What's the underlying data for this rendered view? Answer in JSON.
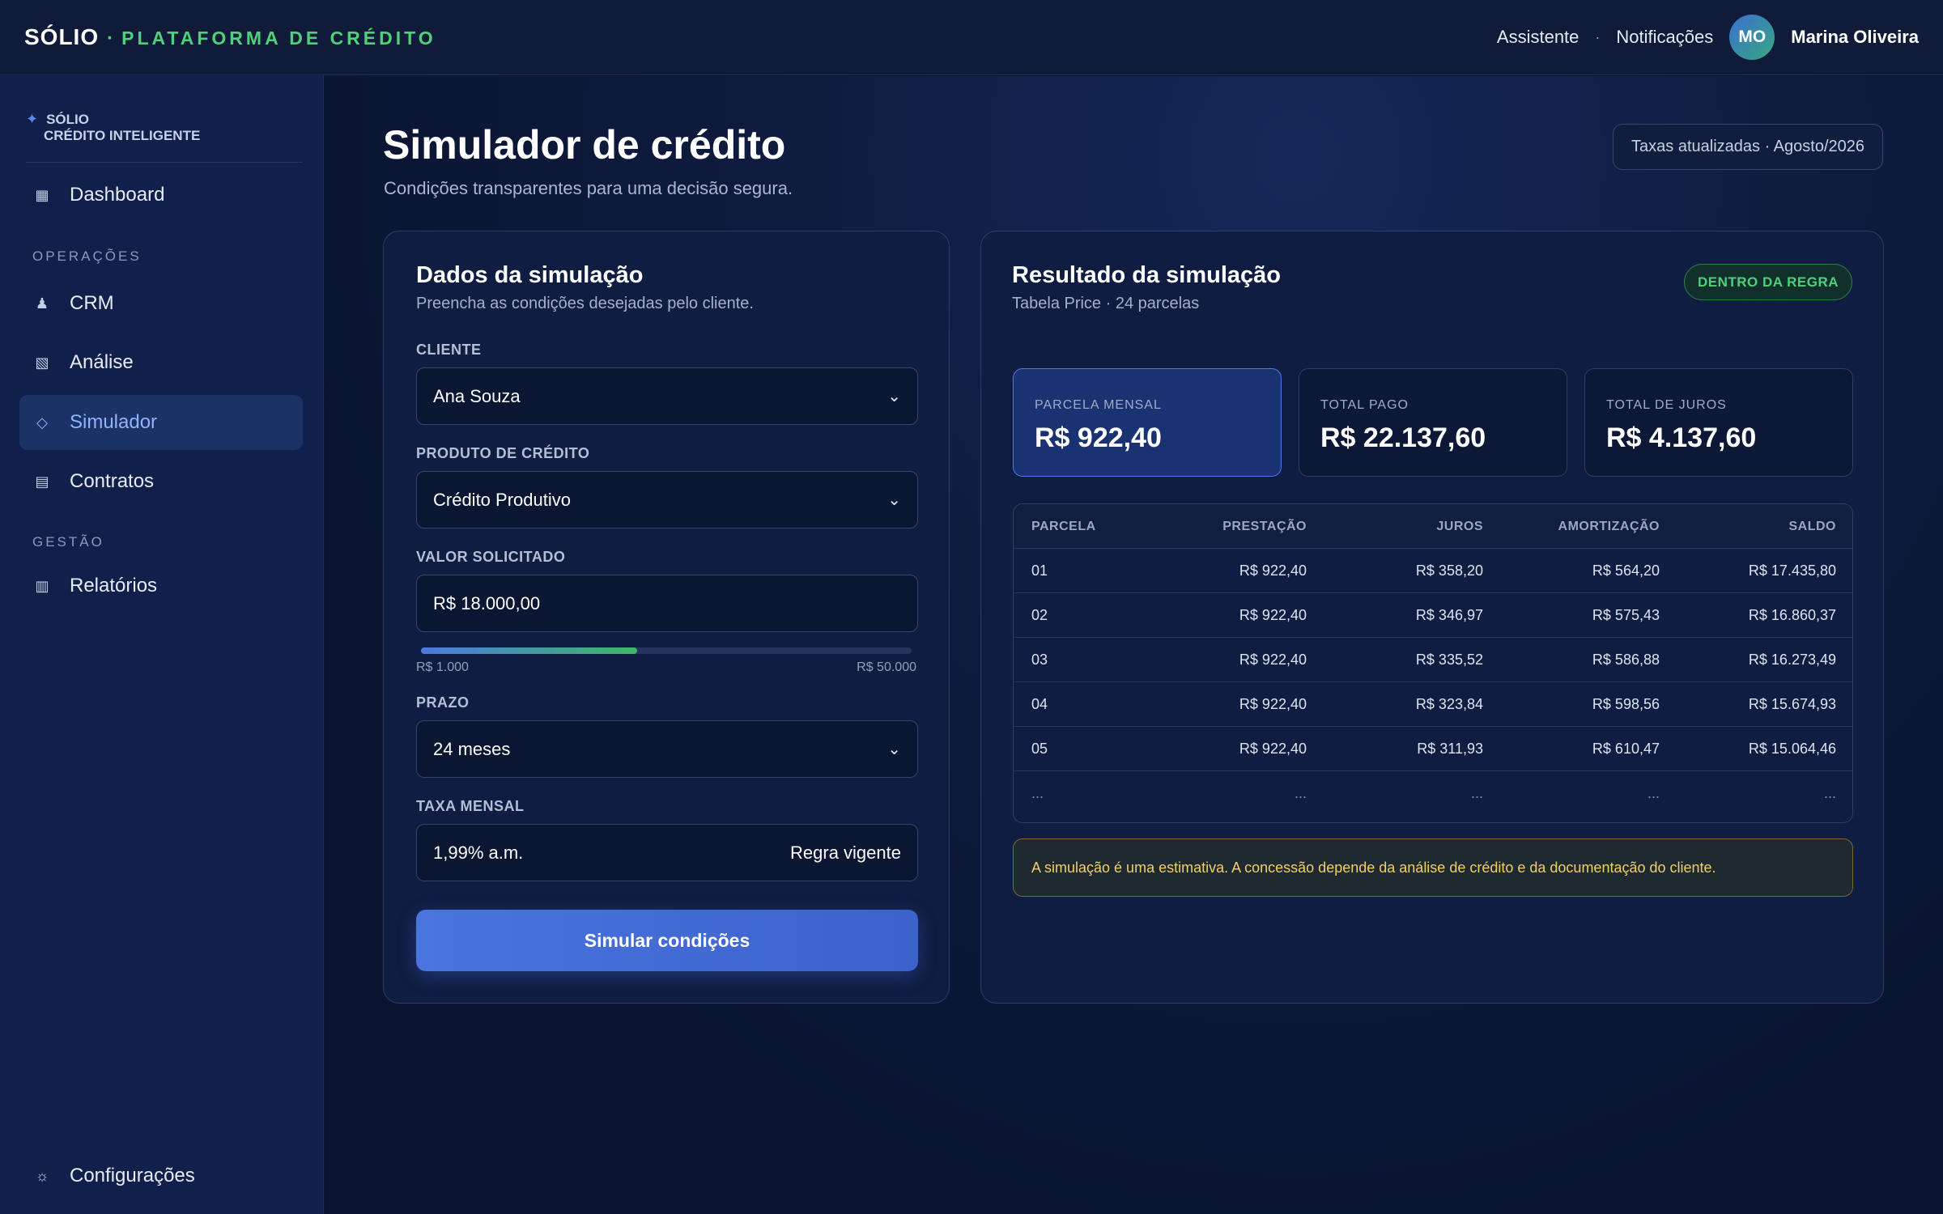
{
  "topbar": {
    "brand": "SÓLIO",
    "brand_dot": "·",
    "brand_sub": "PLATAFORMA DE CRÉDITO",
    "assistant": "Assistente",
    "separator": "·",
    "notifications": "Notificações",
    "avatar_initials": "MO",
    "user_name": "Marina Oliveira"
  },
  "sidebar": {
    "brand_line1": "SÓLIO",
    "brand_line2": "CRÉDITO INTELIGENTE",
    "items": [
      {
        "label": "Dashboard",
        "icon": "dashboard-grid-icon"
      },
      {
        "label": "CRM",
        "icon": "person-icon"
      },
      {
        "label": "Análise",
        "icon": "analysis-icon"
      },
      {
        "label": "Simulador",
        "icon": "diamond-icon",
        "active": true
      },
      {
        "label": "Contratos",
        "icon": "document-icon"
      },
      {
        "label": "Relatórios",
        "icon": "report-icon"
      },
      {
        "label": "Configurações",
        "icon": "gear-icon"
      }
    ],
    "section_operations": "OPERAÇÕES",
    "section_management": "GESTÃO"
  },
  "page": {
    "title": "Simulador de crédito",
    "subtitle": "Condições transparentes para uma decisão segura.",
    "rate_badge": "Taxas atualizadas · Agosto/2026"
  },
  "form": {
    "title": "Dados da simulação",
    "subtitle": "Preencha as condições desejadas pelo cliente.",
    "client_label": "CLIENTE",
    "client_value": "Ana Souza",
    "product_label": "PRODUTO DE CRÉDITO",
    "product_value": "Crédito Produtivo",
    "amount_label": "VALOR SOLICITADO",
    "amount_value": "R$ 18.000,00",
    "amount_slider_fraction": 0.44,
    "range_min": "R$ 1.000",
    "range_max": "R$ 50.000",
    "term_label": "PRAZO",
    "term_value": "24 meses",
    "rate_label": "TAXA MENSAL",
    "rate_value": "1,99% a.m.",
    "rate_note": "Regra vigente",
    "submit": "Simular condições"
  },
  "result": {
    "title": "Resultado da simulação",
    "subtitle": "Tabela Price · 24 parcelas",
    "status": "DENTRO DA REGRA",
    "kpis": [
      {
        "label": "PARCELA MENSAL",
        "value": "R$ 922,40"
      },
      {
        "label": "TOTAL PAGO",
        "value": "R$ 22.137,60"
      },
      {
        "label": "TOTAL DE JUROS",
        "value": "R$ 4.137,60"
      }
    ],
    "table": {
      "headers": [
        "PARCELA",
        "PRESTAÇÃO",
        "JUROS",
        "AMORTIZAÇÃO",
        "SALDO"
      ],
      "rows": [
        [
          "01",
          "R$ 922,40",
          "R$ 358,20",
          "R$ 564,20",
          "R$ 17.435,80"
        ],
        [
          "02",
          "R$ 922,40",
          "R$ 346,97",
          "R$ 575,43",
          "R$ 16.860,37"
        ],
        [
          "03",
          "R$ 922,40",
          "R$ 335,52",
          "R$ 586,88",
          "R$ 16.273,49"
        ],
        [
          "04",
          "R$ 922,40",
          "R$ 323,84",
          "R$ 598,56",
          "R$ 15.674,93"
        ],
        [
          "05",
          "R$ 922,40",
          "R$ 311,93",
          "R$ 610,47",
          "R$ 15.064,46"
        ],
        [
          "...",
          "...",
          "...",
          "...",
          "..."
        ]
      ]
    },
    "notice": "A simulação é uma estimativa. A concessão depende da análise de crédito e da documentação do cliente."
  },
  "colors": {
    "accent_green": "#4fd07a",
    "accent_blue": "#4a74de",
    "notice_yellow": "#f0cf6a"
  }
}
